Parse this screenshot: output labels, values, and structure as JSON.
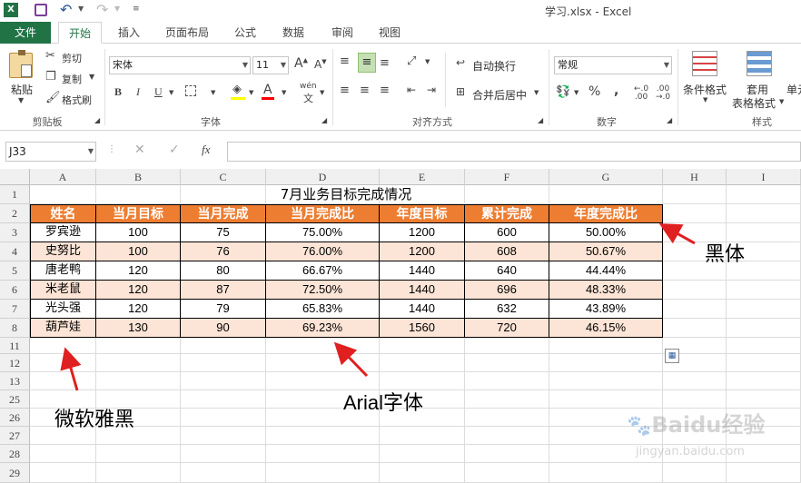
{
  "window": {
    "title": "学习.xlsx - Excel"
  },
  "tabs": [
    "文件",
    "开始",
    "插入",
    "页面布局",
    "公式",
    "数据",
    "审阅",
    "视图"
  ],
  "ribbon": {
    "clipboard": {
      "paste": "粘贴",
      "cut": "剪切",
      "copy": "复制",
      "format_painter": "格式刷",
      "group": "剪贴板"
    },
    "font": {
      "font_name": "宋体",
      "font_size": "11",
      "bold": "B",
      "italic": "I",
      "underline": "U",
      "grow": "A",
      "shrink": "A",
      "wen": "wén",
      "group": "字体"
    },
    "alignment": {
      "wrap": "自动换行",
      "merge": "合并后居中",
      "group": "对齐方式"
    },
    "number": {
      "format": "常规",
      "percent": "%",
      "comma": ",",
      "group": "数字"
    },
    "styles": {
      "conditional": "条件格式",
      "table": "套用",
      "table2": "表格格式",
      "cell": "单元",
      "group": "样式"
    }
  },
  "formula_bar": {
    "name_box": "J33",
    "fx": "fx",
    "value": ""
  },
  "columns": [
    "A",
    "B",
    "C",
    "D",
    "E",
    "F",
    "G",
    "H",
    "I"
  ],
  "rows": [
    "1",
    "2",
    "3",
    "4",
    "5",
    "6",
    "7",
    "8",
    "11",
    "12",
    "13",
    "25",
    "26",
    "27",
    "28",
    "29"
  ],
  "sheet": {
    "title": "7月业务目标完成情况",
    "headers": [
      "姓名",
      "当月目标",
      "当月完成",
      "当月完成比",
      "年度目标",
      "累计完成",
      "年度完成比"
    ],
    "data": [
      [
        "罗宾逊",
        "100",
        "75",
        "75.00%",
        "1200",
        "600",
        "50.00%"
      ],
      [
        "史努比",
        "100",
        "76",
        "76.00%",
        "1200",
        "608",
        "50.67%"
      ],
      [
        "唐老鸭",
        "120",
        "80",
        "66.67%",
        "1440",
        "640",
        "44.44%"
      ],
      [
        "米老鼠",
        "120",
        "87",
        "72.50%",
        "1440",
        "696",
        "48.33%"
      ],
      [
        "光头强",
        "120",
        "79",
        "65.83%",
        "1440",
        "632",
        "43.89%"
      ],
      [
        "葫芦娃",
        "130",
        "90",
        "69.23%",
        "1560",
        "720",
        "46.15%"
      ]
    ]
  },
  "annotations": {
    "heiti": "黑体",
    "yahei": "微软雅黑",
    "arial": "Arial字体"
  },
  "watermark": {
    "brand": "Baidu经验",
    "url": "jingyan.baidu.com"
  },
  "colors": {
    "excel_green": "#217346",
    "header_orange": "#ed7d31",
    "alt_row": "#fce4d6",
    "arrow_red": "#e02020"
  }
}
